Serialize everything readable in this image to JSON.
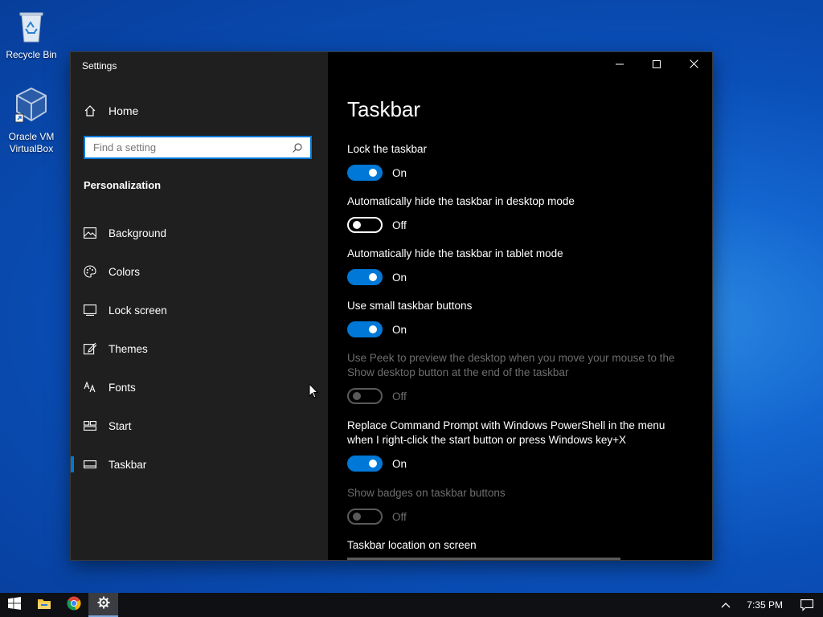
{
  "desktop": {
    "icons": [
      {
        "label": "Recycle Bin",
        "icon": "recycle-bin-icon"
      },
      {
        "label": "Oracle VM\nVirtualBox",
        "icon": "virtualbox-icon"
      }
    ]
  },
  "window": {
    "title": "Settings",
    "sidebar": {
      "home_label": "Home",
      "search_placeholder": "Find a setting",
      "section_title": "Personalization",
      "items": [
        {
          "label": "Background",
          "icon": "picture-icon"
        },
        {
          "label": "Colors",
          "icon": "palette-icon"
        },
        {
          "label": "Lock screen",
          "icon": "monitor-icon"
        },
        {
          "label": "Themes",
          "icon": "brush-icon"
        },
        {
          "label": "Fonts",
          "icon": "font-icon"
        },
        {
          "label": "Start",
          "icon": "start-tiles-icon"
        },
        {
          "label": "Taskbar",
          "icon": "taskbar-icon",
          "active": true
        }
      ]
    },
    "content": {
      "title": "Taskbar",
      "settings": [
        {
          "label": "Lock the taskbar",
          "state": "On",
          "on": true,
          "enabled": true
        },
        {
          "label": "Automatically hide the taskbar in desktop mode",
          "state": "Off",
          "on": false,
          "enabled": true
        },
        {
          "label": "Automatically hide the taskbar in tablet mode",
          "state": "On",
          "on": true,
          "enabled": true
        },
        {
          "label": "Use small taskbar buttons",
          "state": "On",
          "on": true,
          "enabled": true
        },
        {
          "label": "Use Peek to preview the desktop when you move your mouse to the Show desktop button at the end of the taskbar",
          "state": "Off",
          "on": false,
          "enabled": false
        },
        {
          "label": "Replace Command Prompt with Windows PowerShell in the menu when I right-click the start button or press Windows key+X",
          "state": "On",
          "on": true,
          "enabled": true
        },
        {
          "label": "Show badges on taskbar buttons",
          "state": "Off",
          "on": false,
          "enabled": false
        }
      ],
      "location_label": "Taskbar location on screen"
    }
  },
  "taskbar": {
    "apps": [
      "windows-start-icon",
      "file-explorer-icon",
      "chrome-icon",
      "settings-gear-icon"
    ],
    "active_app": "settings-gear-icon",
    "clock": "7:35 PM"
  },
  "colors": {
    "accent": "#0078d7",
    "sidebar_bg": "#1f1f1f",
    "content_bg": "#000000",
    "disabled_text": "#6d6d6d"
  }
}
